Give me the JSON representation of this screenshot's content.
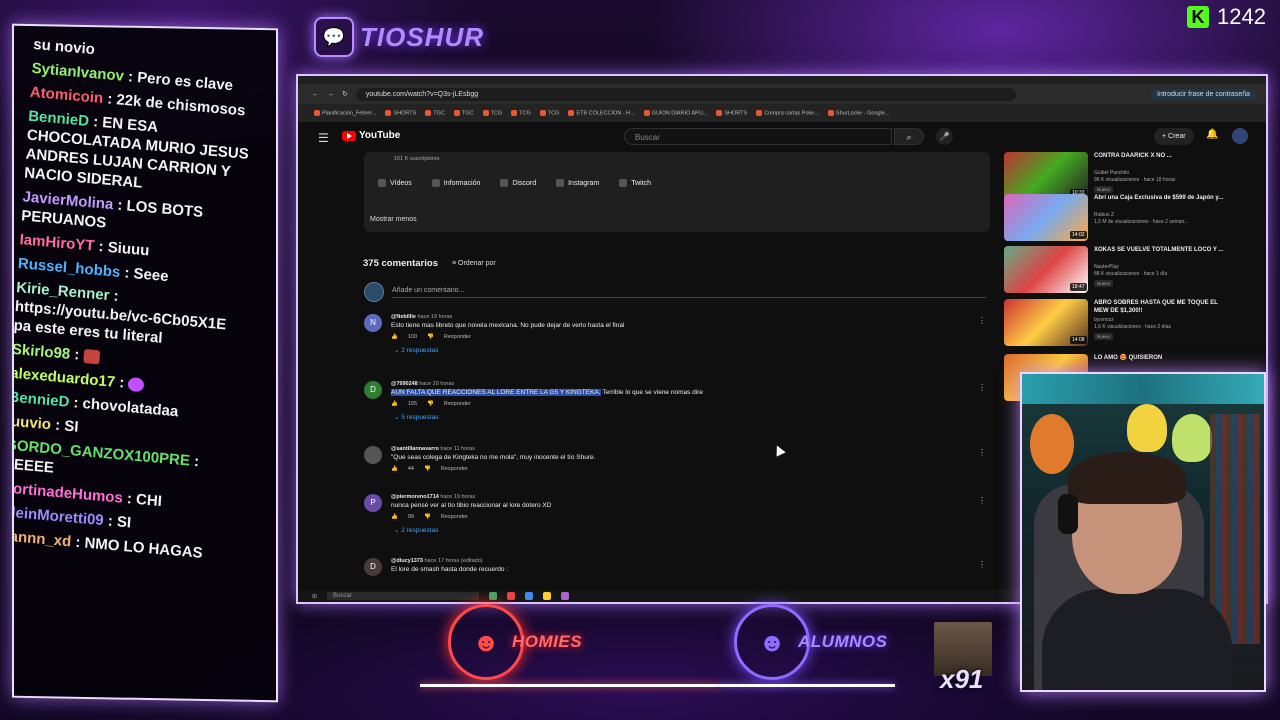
{
  "chat": [
    {
      "user": "",
      "user_color": "#f3f3f3",
      "text": "su novio"
    },
    {
      "user": "SytianIvanov",
      "user_color": "#8ff26d",
      "text": ": Pero es clave"
    },
    {
      "user": "Atomicoin",
      "user_color": "#ff5d6a",
      "text": ": 22k de chismosos"
    },
    {
      "user": "BennieD",
      "user_color": "#52e3a5",
      "text": ": EN ESA CHOCOLATADA MURIO JESUS ANDRES LUJAN CARRION Y NACIO SIDERAL"
    },
    {
      "user": "JavierMolina",
      "user_color": "#c29bff",
      "text": ": LOS BOTS PERUANOS"
    },
    {
      "user": "IamHiroYT",
      "user_color": "#ff6c9c",
      "text": ": Siuuu"
    },
    {
      "user": "Russel_hobbs",
      "user_color": "#4fb4ff",
      "text": ": Seee"
    },
    {
      "user": "Kirie_Renner",
      "user_color": "#a6f2c8",
      "text": ": https://youtu.be/vc-6Cb05X1E pa este eres tu literal"
    },
    {
      "user": "Skirlo98",
      "user_color": "#a7f77a",
      "text": ":",
      "emote": "red"
    },
    {
      "user": "alexeduardo17",
      "user_color": "#c1ff61",
      "text": ":",
      "emote": "purple"
    },
    {
      "user": "BennieD",
      "user_color": "#52e3a5",
      "text": ": chovolatadaa"
    },
    {
      "user": "juuvio",
      "user_color": "#f2e27a",
      "text": ": SI"
    },
    {
      "user": "GORDO_GANZOX100PRE",
      "user_color": "#66e06b",
      "text": ": SEEEE"
    },
    {
      "user": "CortinadeHumos",
      "user_color": "#ff6ed4",
      "text": ": CHI"
    },
    {
      "user": "KleinMoretti09",
      "user_color": "#9b8cff",
      "text": ": SI"
    },
    {
      "user": "Dannn_xd",
      "user_color": "#f2b36e",
      "text": ": NMO LO HAGAS"
    }
  ],
  "brand": {
    "name": "TIOSHUR",
    "logo_icon": "twitch-icon"
  },
  "kick": {
    "count": "1242",
    "logo": "K"
  },
  "browser": {
    "url": "youtube.com/watch?v=Q3s-jLEsbgg",
    "autofill": "Introducir frase de contraseña",
    "bookmarks": [
      "Planificación_Febrer...",
      "SHORTS",
      "TGC",
      "TGC",
      "TCG",
      "TCG",
      "TCG",
      "ETB COLECCION - H...",
      "GUION DIARIO APU...",
      "SHORTS",
      "Compra cartas Poke...",
      "ShurLocke - Google..."
    ]
  },
  "youtube": {
    "logo": "YouTube",
    "search_placeholder": "Buscar",
    "create": "Crear",
    "channel_subs": "161 K suscriptores",
    "links": [
      "Vídeos",
      "Información",
      "Discord",
      "Instagram",
      "Twitch"
    ],
    "show_less": "Mostrar menos",
    "comment_count": "375 comentarios",
    "sort_by": "Ordenar por",
    "add_comment": "Añade un comentario...",
    "comments": [
      {
        "avatar": "N",
        "color": "#5c6bc0",
        "user": "@Nebillle",
        "time": "hace 19 horas",
        "text": "Esto tiene mas libreto que novela mexicana. No pude dejar de verlo hasta el final",
        "likes": "100",
        "reply": "Responder",
        "replies": "2 respuestas"
      },
      {
        "avatar": "D",
        "color": "#2e7d32",
        "user": "@7990248",
        "time": "hace 20 horas",
        "highlight": "AUN FALTA QUE REACCIONES AL LORE ENTRE LA G5 Y KINGTEKA.",
        "text": " Terrible lo que se viene nomas dire",
        "likes": "195",
        "reply": "Responder",
        "replies": "5 respuestas"
      },
      {
        "avatar": "",
        "color": "#555",
        "user": "@santillannavarro",
        "time": "hace 11 horas",
        "text": "\"Que seas colega de Kingteka no me mola\", muy inocente el tío Shure.",
        "likes": "44",
        "reply": "Responder",
        "replies": ""
      },
      {
        "avatar": "P",
        "color": "#6a4ca8",
        "user": "@piermoreno1714",
        "time": "hace 19 horas",
        "text": "nunca pensé ver al tío tibio reaccionar al lore dotero XD",
        "likes": "99",
        "reply": "Responder",
        "replies": "2 respuestas"
      },
      {
        "avatar": "D",
        "color": "#4a3a3a",
        "user": "@dlucy1373",
        "time": "hace 17 horas (editado)",
        "text": "El lore de smash hasta donde recuerdo :",
        "likes": "",
        "reply": "",
        "replies": ""
      }
    ],
    "recs": [
      {
        "title": "CONTRA DAARICK X NO ...",
        "channel": "Guibel Panchito",
        "stats": "96 K visualizaciones · hace 18 horas",
        "badge": "Nuevo",
        "duration": "10:33",
        "thumb": "linear-gradient(135deg,#b33,#4a2,#222)"
      },
      {
        "title": "Abrí una Caja Exclusiva de $599 de Japón y...",
        "channel": "Rubius Z",
        "stats": "1,5 M de visualizaciones · hace 2 seman...",
        "badge": "",
        "duration": "14:02",
        "thumb": "linear-gradient(135deg,#d6b,#7ae,#fa4)"
      },
      {
        "title": "XOKAS SE VUELVE TOTALMENTE LOCO Y ...",
        "channel": "NauterPlay",
        "stats": "88 K visualizaciones · hace 1 día",
        "badge": "Nuevo",
        "duration": "18:47",
        "thumb": "linear-gradient(135deg,#6a8,#d44,#fff)"
      },
      {
        "title": "ABRO SOBRES HASTA QUE ME TOQUE EL MEW DE $1,300!!",
        "channel": "bysmozz",
        "stats": "1,6 K visualizaciones · hace 2 días",
        "badge": "Nuevo",
        "duration": "14:08",
        "thumb": "linear-gradient(135deg,#c33,#fc4,#532)"
      },
      {
        "title": "LO AMO 😍 QUISIERON",
        "channel": "",
        "stats": "",
        "badge": "",
        "duration": "",
        "thumb": "linear-gradient(135deg,#d63,#fc3,#a22)"
      }
    ],
    "taskbar_search": "Buscar"
  },
  "badges": {
    "homies": "HOMIES",
    "alumnos": "ALUMNOS",
    "meme_count": "x91"
  },
  "colors": {
    "accent": "#b98cff",
    "homies": "#ff4a4a",
    "alumnos": "#8f6bff",
    "link": "#3ea6ff"
  }
}
